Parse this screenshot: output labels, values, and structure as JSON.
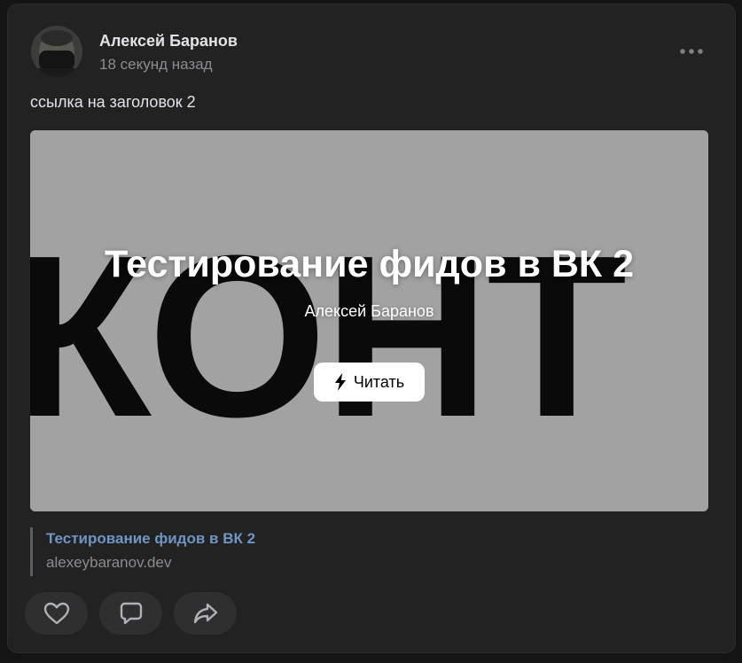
{
  "post": {
    "author": "Алексей Баранов",
    "time": "18 секунд назад",
    "text": "ссылка на заголовок 2"
  },
  "card": {
    "background_word": "КОНТ",
    "title": "Тестирование фидов в ВК 2",
    "author": "Алексей Баранов",
    "read_label": "Читать"
  },
  "link": {
    "title": "Тестирование фидов в ВК 2",
    "domain": "alexeybaranov.dev"
  },
  "actions": {
    "like_icon": "heart-icon",
    "comment_icon": "comment-icon",
    "share_icon": "share-icon"
  },
  "colors": {
    "background": "#141414",
    "post_bg": "#222222",
    "link_accent": "#6f95c4",
    "card_bg": "#a2a2a2"
  }
}
